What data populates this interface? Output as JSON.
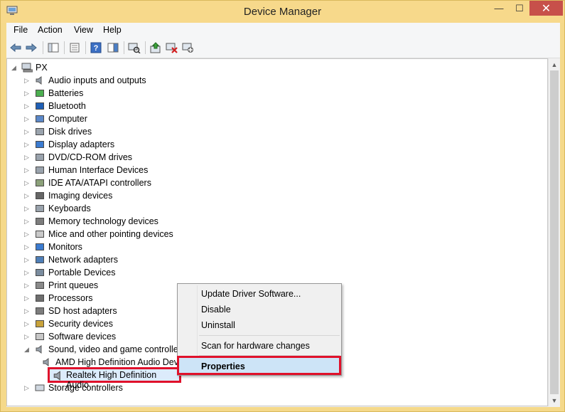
{
  "window": {
    "title": "Device Manager",
    "minimize": "—",
    "maximize": "☐",
    "close": "✕"
  },
  "menu": [
    "File",
    "Action",
    "View",
    "Help"
  ],
  "tree": {
    "root": "PX",
    "categories": [
      {
        "label": "Audio inputs and outputs",
        "icon": "speaker-icon"
      },
      {
        "label": "Batteries",
        "icon": "battery-icon"
      },
      {
        "label": "Bluetooth",
        "icon": "bluetooth-icon"
      },
      {
        "label": "Computer",
        "icon": "computer-icon"
      },
      {
        "label": "Disk drives",
        "icon": "disk-drive-icon"
      },
      {
        "label": "Display adapters",
        "icon": "display-adapter-icon"
      },
      {
        "label": "DVD/CD-ROM drives",
        "icon": "dvd-drive-icon"
      },
      {
        "label": "Human Interface Devices",
        "icon": "hid-icon"
      },
      {
        "label": "IDE ATA/ATAPI controllers",
        "icon": "ide-controller-icon"
      },
      {
        "label": "Imaging devices",
        "icon": "camera-icon"
      },
      {
        "label": "Keyboards",
        "icon": "keyboard-icon"
      },
      {
        "label": "Memory technology devices",
        "icon": "memory-icon"
      },
      {
        "label": "Mice and other pointing devices",
        "icon": "mouse-icon"
      },
      {
        "label": "Monitors",
        "icon": "monitor-icon"
      },
      {
        "label": "Network adapters",
        "icon": "network-icon"
      },
      {
        "label": "Portable Devices",
        "icon": "portable-device-icon"
      },
      {
        "label": "Print queues",
        "icon": "printer-icon"
      },
      {
        "label": "Processors",
        "icon": "processor-icon"
      },
      {
        "label": "SD host adapters",
        "icon": "sd-card-icon"
      },
      {
        "label": "Security devices",
        "icon": "security-key-icon"
      },
      {
        "label": "Software devices",
        "icon": "software-device-icon"
      },
      {
        "label": "Sound, video and game controllers",
        "icon": "speaker-icon"
      }
    ],
    "children": [
      {
        "label": "AMD High Definition Audio Device"
      },
      {
        "label": "Realtek High Definition Audio"
      }
    ],
    "after": "Storage controllers"
  },
  "context_menu": {
    "update": "Update Driver Software...",
    "disable": "Disable",
    "uninstall": "Uninstall",
    "scan": "Scan for hardware changes",
    "properties": "Properties"
  },
  "colors": {
    "highlight_border": "#e0112b",
    "title_bar": "#f7d98b",
    "close_button": "#c7504a"
  }
}
